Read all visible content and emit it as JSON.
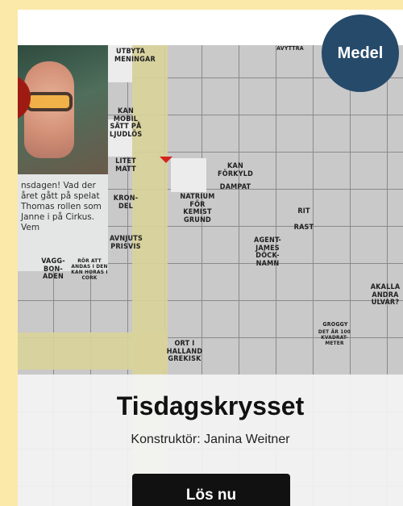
{
  "card": {
    "difficulty": "Medel",
    "title": "Tisdagskrysset",
    "constructor": "Konstruktör: Janina Weitner",
    "button_label": "Lös nu"
  },
  "puzzle_preview": {
    "story_text": "nsdagen! Vad der året gått på spelat Thomas rollen som Janne i på Cirkus. Vem",
    "clues": [
      "UTBYTA MENINGAR",
      "AVYTTRA",
      "KAN MOBIL SÄTT PÅ LJUDLÖS",
      "LITET MATT",
      "KRON-DEL",
      "NATRIUM FÖR KEMIST GRUND",
      "KAN FÖRKYLD",
      "DAMPAT",
      "RIT",
      "RAST",
      "AVNJUTS PRISVIS",
      "AGENT-JAMES DÖCK-NAMN",
      "VAGG-BON-ADEN",
      "RÖR ATT ANDAS I DEN KAN HORAS I CORK",
      "AKALLA ANDRA ULVAR?",
      "GROGGY",
      "DET ÄR 100 KVADRAT-METER",
      "ORT I HALLAND GREKISK"
    ]
  },
  "colors": {
    "page_bg": "#fbe9a9",
    "difficulty_bg": "#264a6a",
    "button_bg": "#111111",
    "highlight": "#d9d39a"
  }
}
